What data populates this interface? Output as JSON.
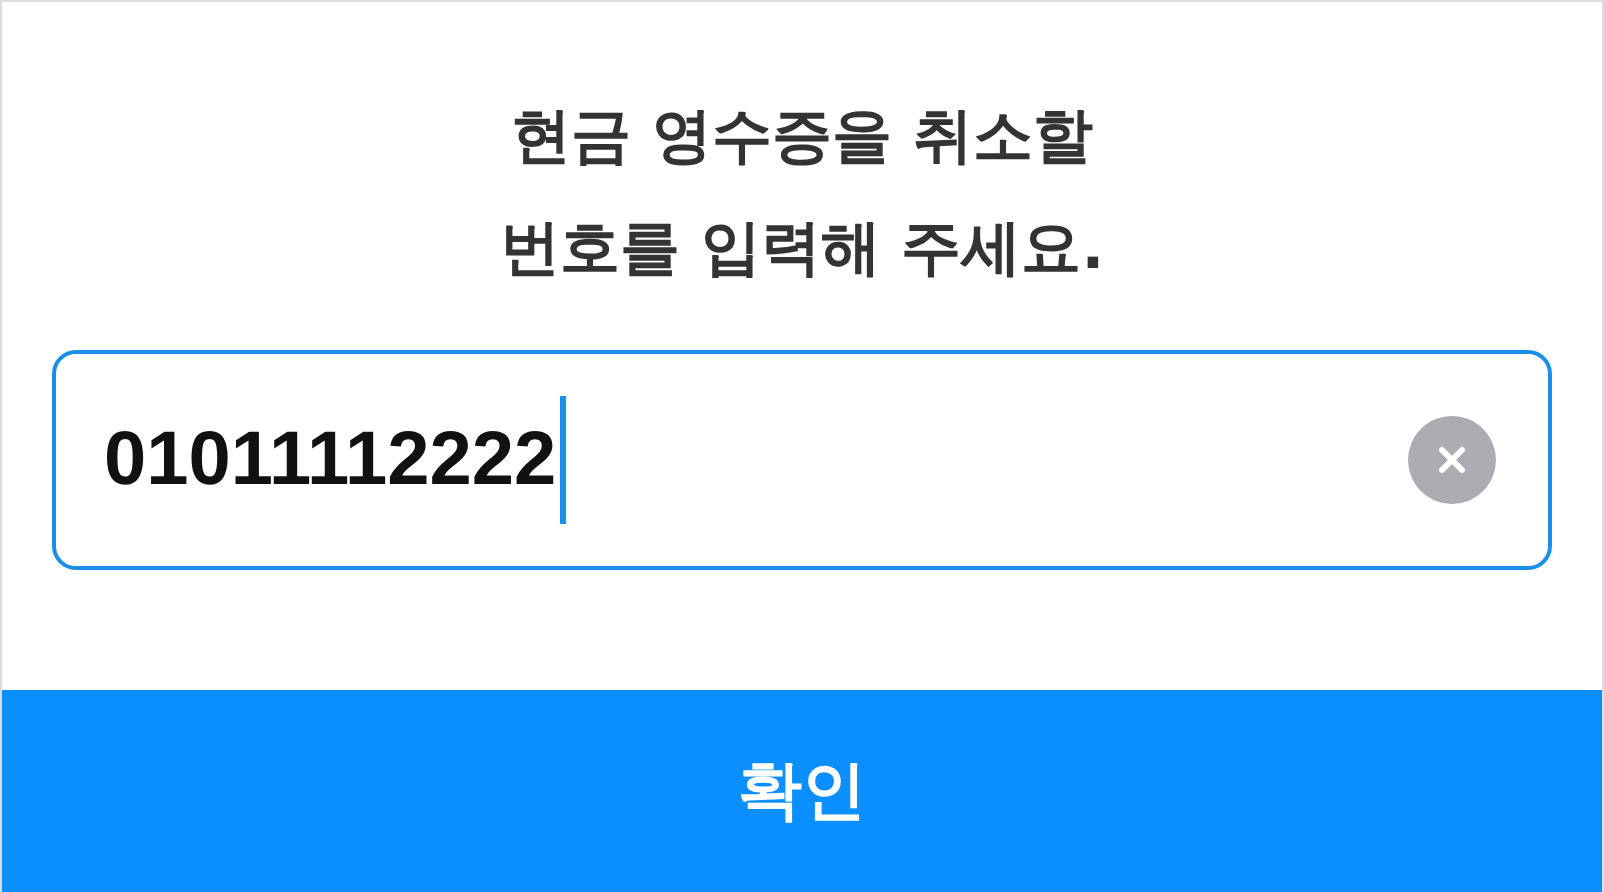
{
  "prompt": {
    "lines": [
      "현금 영수증을 취소할",
      "번호를 입력해 주세요."
    ]
  },
  "field": {
    "value": "01011112222",
    "focused": true
  },
  "confirm_button": {
    "label": "확인"
  }
}
